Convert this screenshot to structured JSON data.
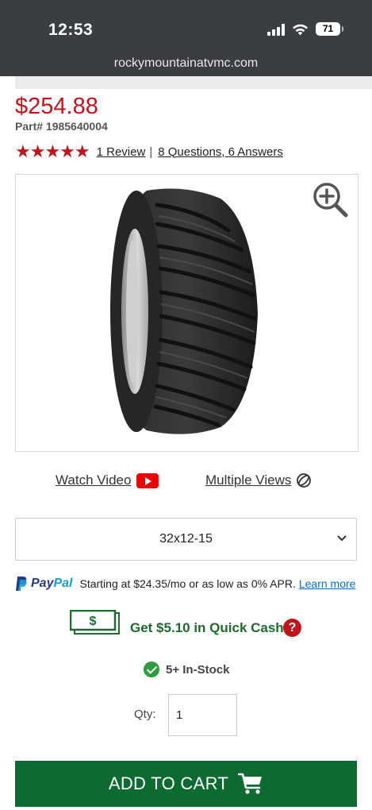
{
  "status_bar": {
    "time": "12:53",
    "battery": "71",
    "url": "rockymountainatvmc.com"
  },
  "product": {
    "price": "$254.88",
    "part_number": "Part# 1985640004",
    "rating_stars": 5,
    "review_link": "1 Review",
    "separator": "|",
    "questions_link": "8 Questions, 6 Answers",
    "image_icon": "zoom-in-icon"
  },
  "media": {
    "watch_video": "Watch Video",
    "multiple_views": "Multiple Views"
  },
  "size_select": {
    "selected": "32x12-15"
  },
  "paypal": {
    "brand_pay": "Pay",
    "brand_pal": "Pal",
    "text": "Starting at $24.35/mo or as low as 0% APR.",
    "learn_more": "Learn more"
  },
  "quick_cash": {
    "symbol": "$",
    "label": "Get $5.10 in Quick Cash",
    "help": "?"
  },
  "stock": {
    "label": "5+ In-Stock"
  },
  "quantity": {
    "label": "Qty:",
    "value": "1"
  },
  "cart": {
    "label": "ADD TO CART"
  },
  "colors": {
    "price_red": "#c0141c",
    "cart_green": "#0d6b31",
    "cash_green": "#1d6b2e"
  }
}
